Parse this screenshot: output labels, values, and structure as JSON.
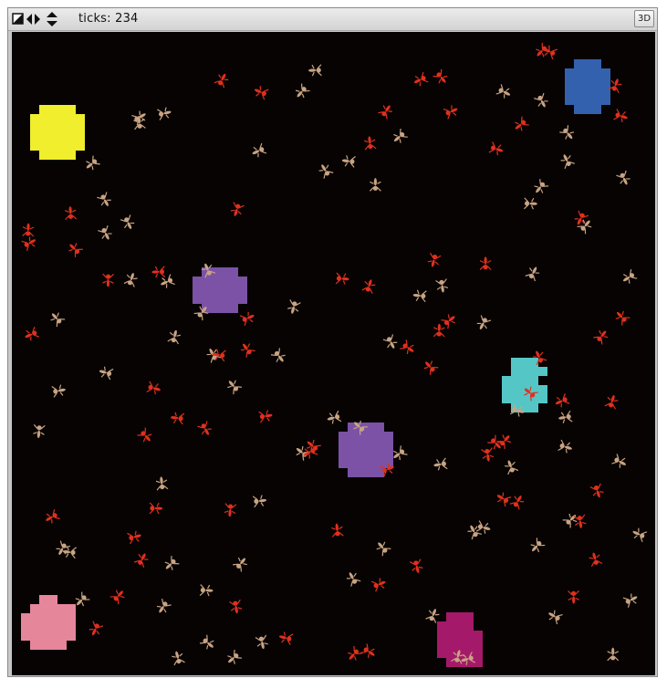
{
  "toolbar": {
    "ticks_label": "ticks:",
    "ticks_value": "234",
    "button_3d": "3D"
  },
  "colors": {
    "background": "#070302",
    "red_ant": "#e0301e",
    "tan_ant": "#c8a483",
    "yellow_patch": "#f0ee2d",
    "blue_patch": "#3461ae",
    "purple_patch": "#7b52a6",
    "cyan_patch": "#55c6c6",
    "pink_patch": "#e5869b",
    "magenta_patch": "#a5196a"
  },
  "world": {
    "patches": [
      {
        "name": "yellow-patch",
        "color": "yellow_patch",
        "shape": "plus"
      },
      {
        "name": "blue-patch",
        "color": "blue_patch",
        "shape": "plus"
      },
      {
        "name": "purple-patch-upper",
        "color": "purple_patch",
        "shape": "plus"
      },
      {
        "name": "purple-patch-lower",
        "color": "purple_patch",
        "shape": "plus"
      },
      {
        "name": "cyan-patch",
        "color": "cyan_patch",
        "shape": "notched"
      },
      {
        "name": "pink-patch",
        "color": "pink_patch",
        "shape": "blob"
      },
      {
        "name": "magenta-patch",
        "color": "magenta_patch",
        "shape": "blob"
      }
    ],
    "red_ant_count": 70,
    "tan_ant_count": 77
  }
}
